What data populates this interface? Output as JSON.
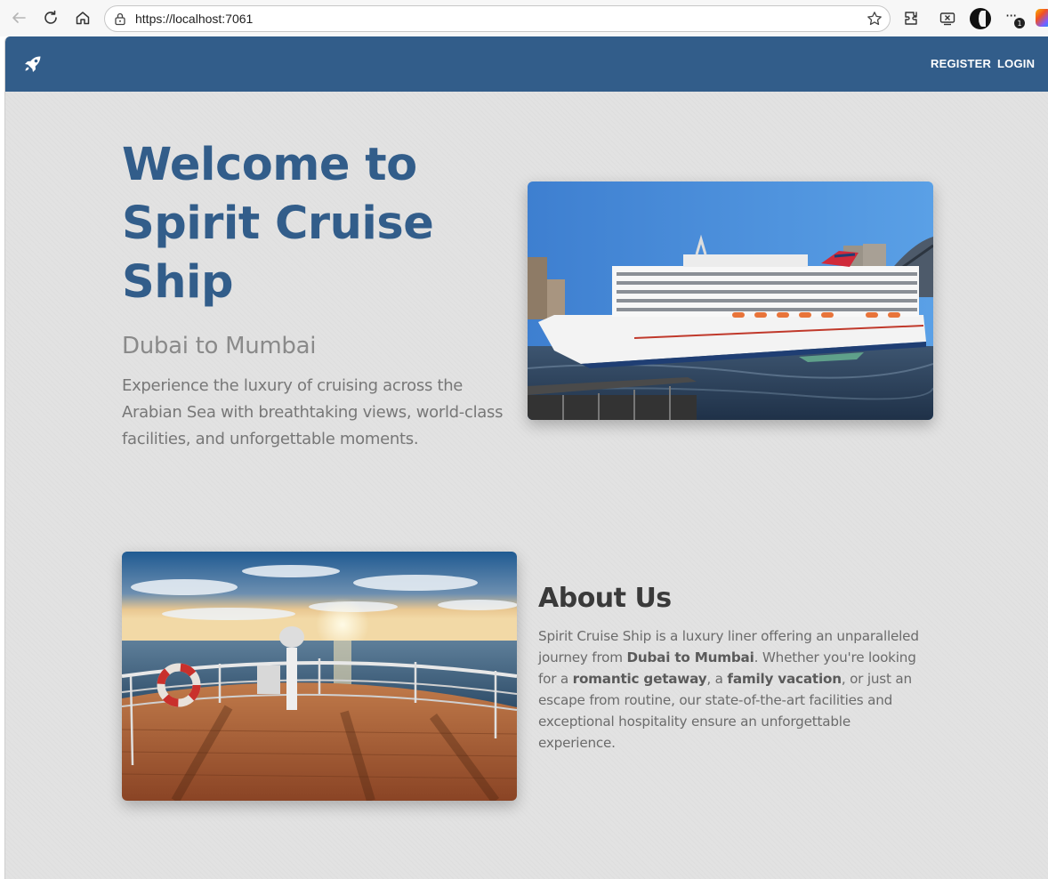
{
  "browser": {
    "url": "https://localhost:7061",
    "notification_count": "1"
  },
  "navbar": {
    "brand_icon": "rocket-icon",
    "links": [
      {
        "label": "REGISTER"
      },
      {
        "label": "LOGIN"
      }
    ]
  },
  "hero": {
    "title": "Welcome to Spirit Cruise Ship",
    "route": "Dubai to Mumbai",
    "description": "Experience the luxury of cruising across the Arabian Sea with breathtaking views, world-class facilities, and unforgettable moments."
  },
  "about": {
    "title": "About Us",
    "text_1": "Spirit Cruise Ship is a luxury liner offering an unparalleled journey from ",
    "bold_1": "Dubai to Mumbai",
    "text_2": ". Whether you're looking for a ",
    "bold_2": "romantic getaway",
    "text_3": ", a ",
    "bold_3": "family vacation",
    "text_4": ", or just an escape from routine, our state-of-the-art facilities and exceptional hospitality ensure an unforgettable experience."
  },
  "colors": {
    "brand": "#325d8a",
    "page_bg": "#e2e2e2"
  }
}
